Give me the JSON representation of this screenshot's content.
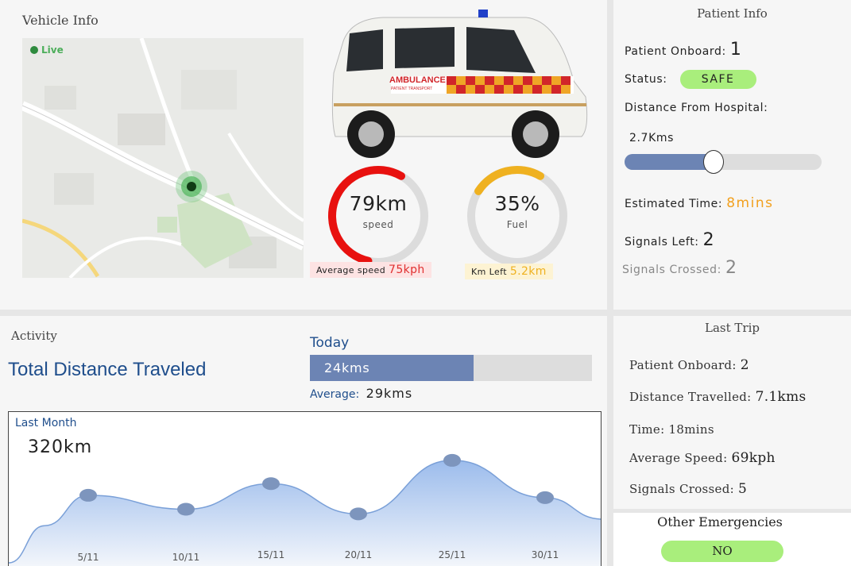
{
  "vehicle": {
    "title": "Vehicle Info",
    "live_label": "Live",
    "van_text": "AMBULANCE",
    "van_subtext": "PATIENT TRANSPORT",
    "speed": {
      "value": "79km",
      "label": "speed",
      "fraction": 0.79,
      "color": "#e8110f"
    },
    "fuel": {
      "value": "35%",
      "label": "Fuel",
      "fraction": 0.35,
      "color": "#efb120"
    },
    "avg_speed_label": "Average speed",
    "avg_speed_value": "75kph",
    "km_left_label": "Km Left",
    "km_left_value": "5.2km"
  },
  "patient": {
    "title": "Patient Info",
    "onboard_label": "Patient Onboard:",
    "onboard_value": "1",
    "status_label": "Status:",
    "status_value": "SAFE",
    "distance_label": "Distance From Hospital:",
    "distance_value": "2.7Kms",
    "distance_progress": 0.45,
    "eta_label": "Estimated Time:",
    "eta_value": "8mins",
    "signals_left_label": "Signals Left:",
    "signals_left_value": "2",
    "signals_crossed_label": "Signals Crossed:",
    "signals_crossed_value": "2"
  },
  "activity": {
    "title": "Activity",
    "total_title": "Total Distance Traveled",
    "today_label": "Today",
    "today_value": "24kms",
    "today_progress": 0.58,
    "average_label": "Average:",
    "average_value": "29kms"
  },
  "last_trip": {
    "title": "Last Trip",
    "onboard_label": "Patient Onboard:",
    "onboard_value": "2",
    "distance_label": "Distance Travelled:",
    "distance_value": "7.1kms",
    "time_label": "Time:",
    "time_value": "18mins",
    "avg_speed_label": "Average Speed:",
    "avg_speed_value": "69kph",
    "signals_label": "Signals Crossed:",
    "signals_value": "5"
  },
  "other": {
    "title": "Other Emergencies",
    "value": "NO"
  },
  "colors": {
    "accent_blue": "#1f4e8c",
    "bar_blue": "#6c84b4",
    "safe_green": "#a9ee7c",
    "speed_red": "#e8110f",
    "fuel_orange": "#efb120"
  },
  "chart_data": {
    "type": "area",
    "title": "Last Month",
    "total_label": "320km",
    "categories": [
      "5/11",
      "10/11",
      "15/11",
      "20/11",
      "25/11",
      "30/11"
    ],
    "series": [
      {
        "values": [
          29,
          23,
          34,
          21,
          44,
          28
        ]
      }
    ],
    "ylim": [
      0,
      60
    ],
    "grid": false
  }
}
